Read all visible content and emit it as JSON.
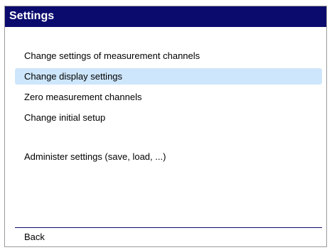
{
  "window": {
    "title": "Settings"
  },
  "colors": {
    "titlebar_bg": "#0b0b6e",
    "selected_bg": "#cde6fb"
  },
  "menu": {
    "items": [
      {
        "label": "Change settings of measurement channels",
        "selected": false
      },
      {
        "label": "Change display settings",
        "selected": true
      },
      {
        "label": "Zero measurement channels",
        "selected": false
      },
      {
        "label": "Change initial setup",
        "selected": false
      },
      {
        "label": "Administer settings (save, load, ...)",
        "selected": false
      }
    ]
  },
  "footer": {
    "back_label": "Back"
  }
}
